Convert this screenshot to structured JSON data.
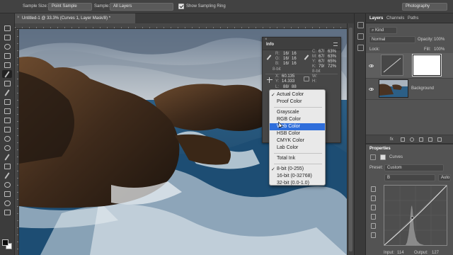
{
  "options_bar": {
    "sample_size_label": "Sample Size:",
    "sample_size_value": "Point Sample",
    "sample_label": "Sample:",
    "sample_value": "All Layers",
    "show_ring_label": "Show Sampling Ring",
    "workspace": "Photography"
  },
  "document": {
    "tab_title": "Untitled-1 @ 33.3% (Curves 1, Layer Mask/8) *",
    "close": "×"
  },
  "info_panel": {
    "title": "Info",
    "close": "×",
    "r_label": "R:",
    "g_label": "G:",
    "b_label": "B:",
    "r_val": "16/",
    "g_val": "16/",
    "b_val": "16/",
    "r_val2": "16",
    "g_val2": "16",
    "b_val2": "16",
    "c_label": "C:",
    "m_label": "M:",
    "y_label": "Y:",
    "k_label": "K:",
    "c_val": "67/",
    "m_val": "67/",
    "y_val": "67/",
    "k_val": "79/",
    "c_val2": "63%",
    "m_val2": "63%",
    "y_val2": "65%",
    "k_val2": "72%",
    "bitdepth_a": "8-bit",
    "bitdepth_b": "8-bit",
    "x_label": "X:",
    "y_coord_label": "Y:",
    "x_val": "60.135",
    "y_val_coord": "14.333",
    "w_label": "W:",
    "h_label": "H:",
    "l_label": "L:",
    "l_val": "88/",
    "l_val2": "88"
  },
  "color_mode_menu": {
    "items": [
      {
        "label": "Actual Color",
        "checked": true,
        "check": "✓"
      },
      {
        "label": "Proof Color",
        "checked": false
      },
      {
        "label": "Grayscale",
        "checked": false
      },
      {
        "label": "RGB Color",
        "checked": false
      },
      {
        "label": "Web Color",
        "checked": false,
        "highlighted": true
      },
      {
        "label": "HSB Color",
        "checked": false
      },
      {
        "label": "CMYK Color",
        "checked": false
      },
      {
        "label": "Lab Color",
        "checked": false
      },
      {
        "label": "Total Ink",
        "checked": false
      },
      {
        "label": "8-bit (0-255)",
        "checked": true,
        "check": "✓"
      },
      {
        "label": "16-bit (0-32768)",
        "checked": false
      },
      {
        "label": "32-bit (0.0-1.0)",
        "checked": false
      }
    ]
  },
  "layers_panel": {
    "tabs": [
      "Layers",
      "Channels",
      "Paths"
    ],
    "kind_label": "Kind",
    "blend_mode": "Normal",
    "opacity_label": "Opacity:",
    "opacity_value": "100%",
    "lock_label": "Lock:",
    "fill_label": "Fill:",
    "fill_value": "100%",
    "background_layer": "Background",
    "footer_label": "fx"
  },
  "properties_panel": {
    "title": "Properties",
    "adjustment_name": "Curves",
    "preset_label": "Preset:",
    "preset_value": "Custom",
    "channel_value": "B",
    "auto_label": "Auto",
    "input_label": "Input:",
    "input_value": "114",
    "output_label": "Output:",
    "output_value": "127"
  },
  "colors": {
    "menu_highlight": "#2f6edb",
    "panel_bg": "#535353"
  }
}
